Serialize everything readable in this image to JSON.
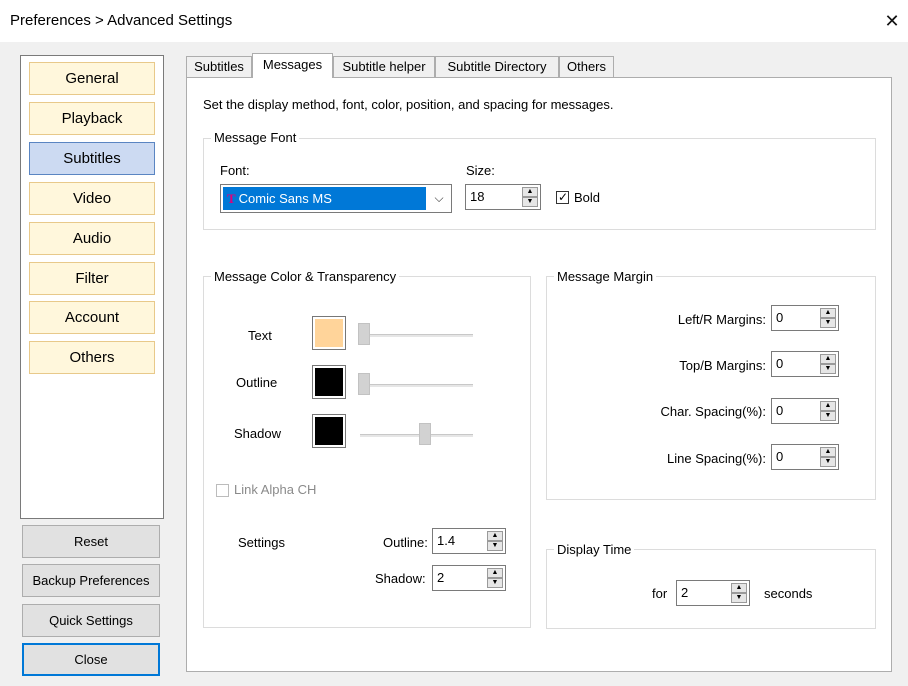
{
  "window": {
    "title": "Preferences > Advanced Settings",
    "close_glyph": "✕"
  },
  "nav": {
    "items": [
      {
        "label": "General"
      },
      {
        "label": "Playback"
      },
      {
        "label": "Subtitles",
        "selected": true
      },
      {
        "label": "Video"
      },
      {
        "label": "Audio"
      },
      {
        "label": "Filter"
      },
      {
        "label": "Account"
      },
      {
        "label": "Others"
      }
    ],
    "selected_color": "#ccdaf2",
    "item_color": "#fff7dc"
  },
  "buttons": {
    "reset": "Reset",
    "backup": "Backup Preferences",
    "quick": "Quick Settings",
    "close": "Close"
  },
  "tabs": {
    "items": [
      "Subtitles",
      "Messages",
      "Subtitle helper",
      "Subtitle Directory",
      "Others"
    ],
    "active": "Messages"
  },
  "page": {
    "description": "Set the display method, font, color, position, and spacing for messages."
  },
  "font_group": {
    "title": "Message Font",
    "font_label": "Font:",
    "font_icon": "T",
    "font_value": "Comic Sans MS",
    "dropdown_glyph": "⌵",
    "size_label": "Size:",
    "size_value": "18",
    "bold_label": "Bold",
    "bold_checked": true
  },
  "color_group": {
    "title": "Message Color & Transparency",
    "rows": [
      {
        "label": "Text",
        "color": "#ffd49a",
        "slider_value": 0.0
      },
      {
        "label": "Outline",
        "color": "#000000",
        "slider_value": 0.0
      },
      {
        "label": "Shadow",
        "color": "#000000",
        "slider_value": 0.6
      }
    ],
    "link_alpha_label": "Link Alpha CH",
    "link_alpha_checked": false,
    "settings_label": "Settings",
    "outline_label": "Outline:",
    "outline_value": "1.4",
    "shadow_label": "Shadow:",
    "shadow_value": "2"
  },
  "margin_group": {
    "title": "Message Margin",
    "rows": [
      {
        "label": "Left/R Margins:",
        "value": "0"
      },
      {
        "label": "Top/B Margins:",
        "value": "0"
      },
      {
        "label": "Char. Spacing(%):",
        "value": "0"
      },
      {
        "label": "Line Spacing(%):",
        "value": "0"
      }
    ]
  },
  "display_time": {
    "title": "Display Time",
    "for_label": "for",
    "value": "2",
    "seconds_label": "seconds"
  },
  "spin_glyphs": {
    "up": "▲",
    "down": "▼"
  }
}
